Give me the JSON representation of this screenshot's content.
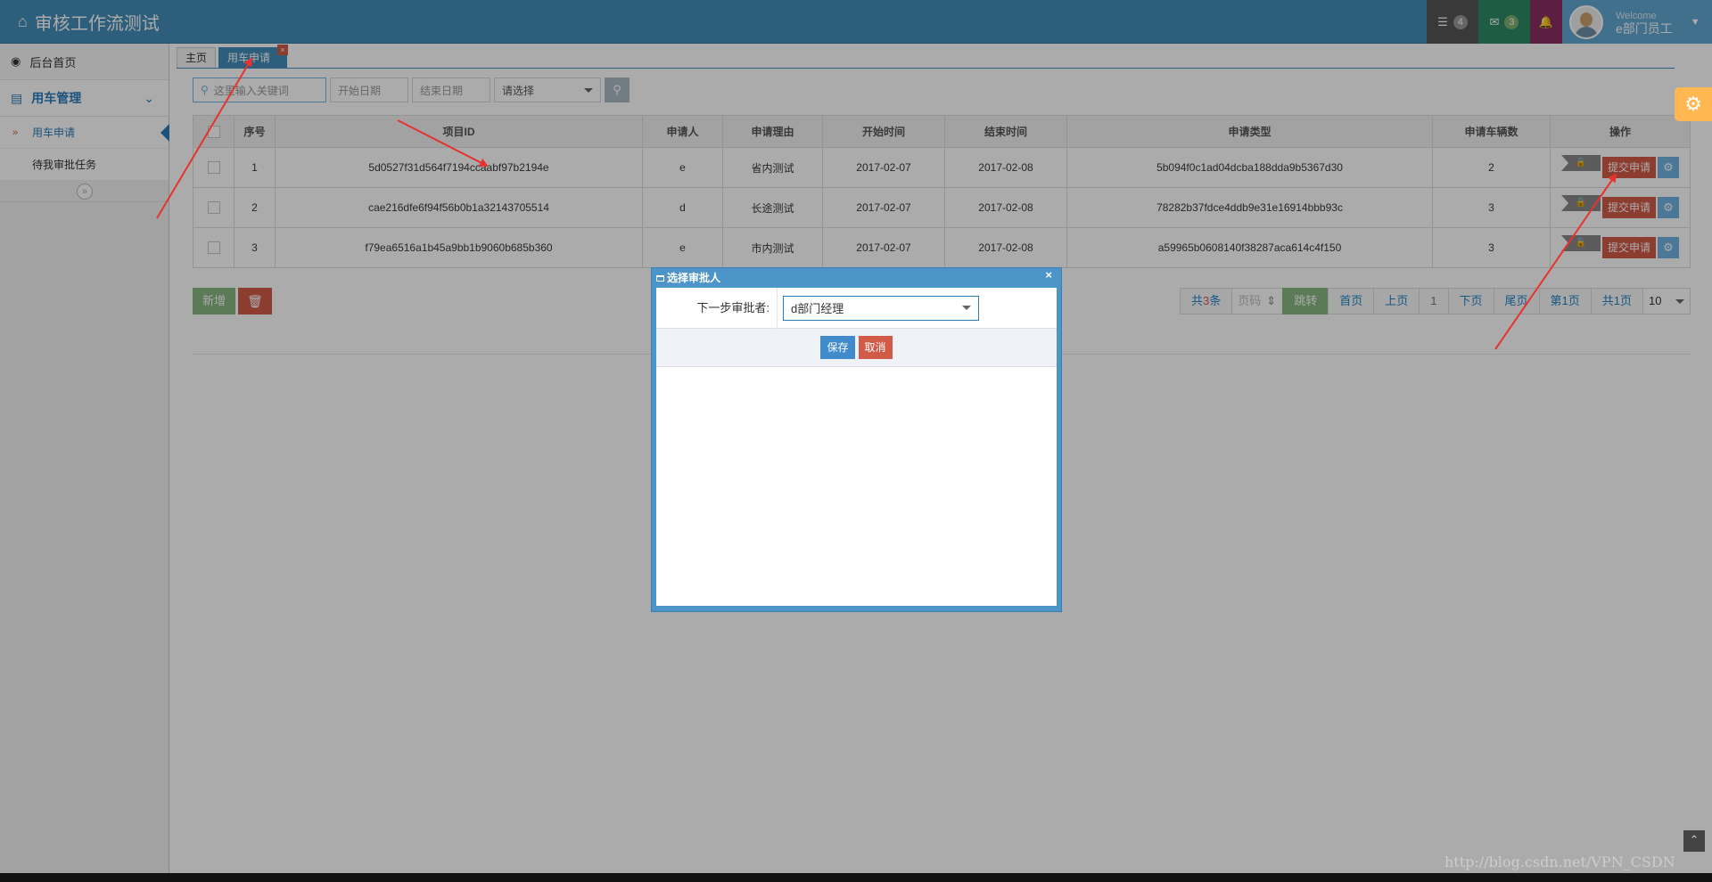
{
  "app": {
    "title": "审核工作流测试"
  },
  "navbar": {
    "tasks_count": "4",
    "messages_count": "3",
    "user": {
      "welcome": "Welcome",
      "name": "e部门员工"
    }
  },
  "sidebar": {
    "home": "后台首页",
    "group": "用车管理",
    "items": [
      {
        "label": "用车申请"
      },
      {
        "label": "待我审批任务"
      }
    ]
  },
  "tabs": [
    {
      "label": "主页"
    },
    {
      "label": "用车申请"
    }
  ],
  "search": {
    "keyword_placeholder": "这里输入关键词",
    "start_placeholder": "开始日期",
    "end_placeholder": "结束日期",
    "select_value": "请选择"
  },
  "table": {
    "headers": [
      "序号",
      "项目ID",
      "申请人",
      "申请理由",
      "开始时间",
      "结束时间",
      "申请类型",
      "申请车辆数",
      "操作"
    ],
    "rows": [
      {
        "no": "1",
        "id": "5d0527f31d564f7194ccaabf97b2194e",
        "applicant": "e",
        "reason": "省内测试",
        "start": "2017-02-07",
        "end": "2017-02-08",
        "type": "5b094f0c1ad04dcba188dda9b5367d30",
        "count": "2"
      },
      {
        "no": "2",
        "id": "cae216dfe6f94f56b0b1a32143705514",
        "applicant": "d",
        "reason": "长途测试",
        "start": "2017-02-07",
        "end": "2017-02-08",
        "type": "78282b37fdce4ddb9e31e16914bbb93c",
        "count": "3"
      },
      {
        "no": "3",
        "id": "f79ea6516a1b45a9bb1b9060b685b360",
        "applicant": "e",
        "reason": "市内测试",
        "start": "2017-02-07",
        "end": "2017-02-08",
        "type": "a59965b0608140f38287aca614c4f150",
        "count": "3"
      }
    ],
    "submit_label": "提交申请"
  },
  "actions": {
    "add_label": "新增"
  },
  "pager": {
    "total_prefix": "共",
    "total_count": "3",
    "total_suffix": "条",
    "page_input_placeholder": "页码",
    "go": "跳转",
    "first": "首页",
    "prev": "上页",
    "current": "1",
    "next": "下页",
    "last": "尾页",
    "page_of": "第1页",
    "total_pages": "共1页",
    "page_size": "10"
  },
  "dialog": {
    "title": "选择审批人",
    "field_label": "下一步审批者:",
    "field_value": "d部门经理",
    "save": "保存",
    "cancel": "取消"
  },
  "watermark": "http://blog.csdn.net/VPN_CSDN",
  "colors": {
    "navbar": "#438eb9",
    "danger": "#d15b47",
    "success": "#87b87f",
    "primary": "#428bca"
  }
}
